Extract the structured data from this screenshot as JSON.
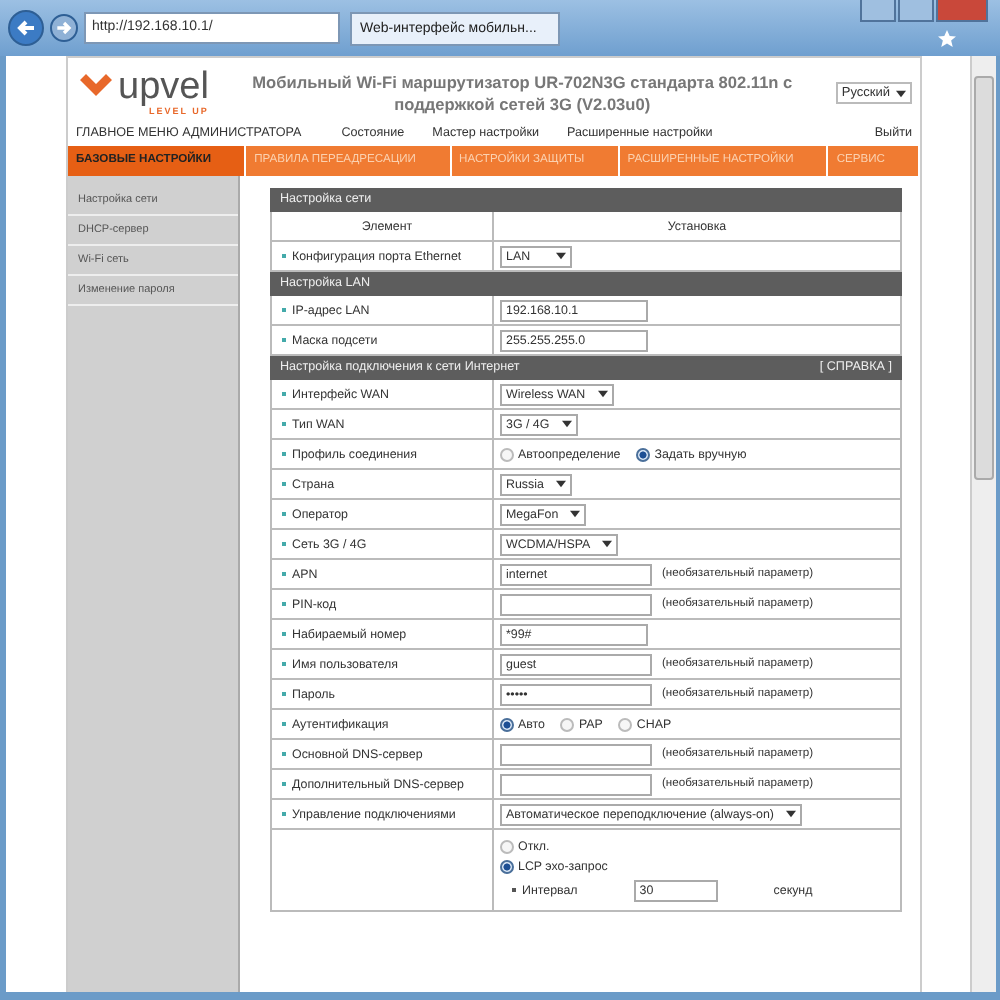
{
  "browser": {
    "address": "http://192.168.10.1/",
    "tab_title": "Web-интерфейс мобильн..."
  },
  "header": {
    "logo": "upvel",
    "tagline": "LEVEL UP",
    "title": "Мобильный Wi-Fi маршрутизатор UR-702N3G стандарта 802.11n с поддержкой сетей 3G  (V2.03u0)",
    "language": "Русский"
  },
  "admin_menu": {
    "title": "ГЛАВНОЕ МЕНЮ АДМИНИСТРАТОРА",
    "links": [
      "Состояние",
      "Мастер настройки",
      "Расширенные настройки"
    ],
    "logout": "Выйти"
  },
  "tabs": [
    {
      "label": "БАЗОВЫЕ НАСТРОЙКИ",
      "selected": true
    },
    {
      "label": "ПРАВИЛА ПЕРЕАДРЕСАЦИИ",
      "selected": false
    },
    {
      "label": "НАСТРОЙКИ ЗАЩИТЫ",
      "selected": false
    },
    {
      "label": "РАСШИРЕННЫЕ НАСТРОЙКИ",
      "selected": false
    },
    {
      "label": "СЕРВИС",
      "selected": false
    }
  ],
  "sidebar": {
    "items": [
      "Настройка сети",
      "DHCP-сервер",
      "Wi-Fi сеть",
      "Изменение пароля"
    ]
  },
  "sections": [
    {
      "title": "Настройка сети",
      "columns": [
        "Элемент",
        "Установка"
      ],
      "rows": [
        {
          "kind": "select",
          "label": "Конфигурация порта Ethernet",
          "value": "LAN"
        }
      ]
    },
    {
      "title": "Настройка LAN",
      "rows": [
        {
          "kind": "input",
          "label": "IP-адрес LAN",
          "value": "192.168.10.1"
        },
        {
          "kind": "input",
          "label": "Маска подсети",
          "value": "255.255.255.0"
        }
      ]
    },
    {
      "title": "Настройка подключения к сети Интернет",
      "link": "[ СПРАВКА ]",
      "rows": [
        {
          "kind": "select",
          "label": "Интерфейс WAN",
          "value": "Wireless WAN"
        },
        {
          "kind": "select",
          "label": "Тип WAN",
          "value": "3G / 4G"
        },
        {
          "kind": "radio",
          "label": "Профиль соединения",
          "options": [
            {
              "label": "Автоопределение",
              "selected": false
            },
            {
              "label": "Задать вручную",
              "selected": true
            }
          ]
        },
        {
          "kind": "select",
          "label": "Страна",
          "value": "Russia"
        },
        {
          "kind": "select",
          "label": "Оператор",
          "value": "MegaFon"
        },
        {
          "kind": "select",
          "label": "Сеть 3G / 4G",
          "value": "WCDMA/HSPA"
        },
        {
          "kind": "input",
          "label": "APN",
          "value": "internet",
          "note": "(необязательный параметр)"
        },
        {
          "kind": "input",
          "label": "PIN-код",
          "value": "",
          "note": "(необязательный параметр)"
        },
        {
          "kind": "input",
          "label": "Набираемый номер",
          "value": "*99#"
        },
        {
          "kind": "input",
          "label": "Имя пользователя",
          "value": "guest",
          "note": "(необязательный параметр)"
        },
        {
          "kind": "input",
          "label": "Пароль",
          "value": "•••••",
          "note": "(необязательный параметр)"
        },
        {
          "kind": "radio",
          "label": "Аутентификация",
          "options": [
            {
              "label": "Авто",
              "selected": true
            },
            {
              "label": "PAP",
              "selected": false
            },
            {
              "label": "CHAP",
              "selected": false
            }
          ]
        },
        {
          "kind": "input",
          "label": "Основной DNS-сервер",
          "value": "",
          "note": "(необязательный параметр)"
        },
        {
          "kind": "input",
          "label": "Дополнительный DNS-сервер",
          "value": "",
          "note": "(необязательный параметр)"
        },
        {
          "kind": "select",
          "label": "Управление подключениями",
          "value": "Автоматическое переподключение (always-on)"
        },
        {
          "kind": "keepalive",
          "options": [
            {
              "label": "Откл.",
              "selected": false
            },
            {
              "label": "LCP эхо-запрос",
              "selected": true
            }
          ],
          "interval": {
            "label": "Интервал",
            "value": "30",
            "unit": "секунд"
          }
        }
      ]
    }
  ]
}
